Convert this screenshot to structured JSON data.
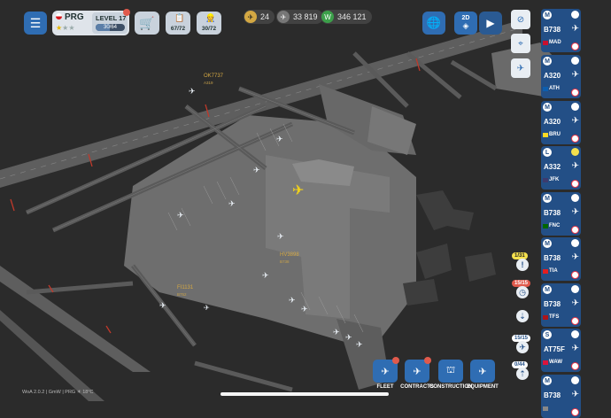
{
  "hud": {
    "airport_code": "PRG",
    "level_label": "LEVEL 17",
    "xp_progress": "30/64",
    "stand_count": "67/72",
    "staff_count": "30/72",
    "stat_planes": "24",
    "stat_coins": "33 819",
    "stat_money": "346 121",
    "view_mode": "2D"
  },
  "flights_map": [
    {
      "callsign": "OK7737",
      "type": "A319"
    },
    {
      "callsign": "HV3898",
      "type": "B738"
    },
    {
      "callsign": "FI1131",
      "type": "B752"
    }
  ],
  "sidebar_cards": [
    {
      "tag": "M",
      "model": "B738",
      "dest": "MAD",
      "flag_color": "#c8102e"
    },
    {
      "tag": "M",
      "model": "A320",
      "dest": "ATH",
      "flag_color": "#0d5eaf"
    },
    {
      "tag": "M",
      "model": "A320",
      "dest": "BRU",
      "flag_color": "#fdda24"
    },
    {
      "tag": "L",
      "model": "A332",
      "dest": "JFK",
      "flag_color": "#3c3b6e"
    },
    {
      "tag": "M",
      "model": "B738",
      "dest": "FNC",
      "flag_color": "#006600"
    },
    {
      "tag": "M",
      "model": "B738",
      "dest": "TIA",
      "flag_color": "#e41e20"
    },
    {
      "tag": "M",
      "model": "B738",
      "dest": "TFS",
      "flag_color": "#aa151b"
    },
    {
      "tag": "S",
      "model": "AT75F",
      "dest": "WAW",
      "flag_color": "#dc143c"
    },
    {
      "tag": "M",
      "model": "B738",
      "dest": "",
      "flag_color": "#888888"
    }
  ],
  "queues": [
    {
      "value": "1/31",
      "bg": "#f4e04d",
      "fg": "#222"
    },
    {
      "value": "15/15",
      "bg": "#e05a4c",
      "fg": "#fff"
    },
    {
      "value": "15/15",
      "bg": "#ffffff",
      "fg": "#234f86"
    },
    {
      "value": "0/44",
      "bg": "#ffffff",
      "fg": "#234f86"
    }
  ],
  "bottom_menu": {
    "fleet": "FLEET",
    "contracts": "CONTRACTS",
    "construction": "CONSTRUCTION",
    "equipment": "EQUIPMENT"
  },
  "footer": "WoA 2.0.2 | GmW | PRG ☀ 18°C",
  "colors": {
    "accent": "#2f6db3",
    "card": "#234f86",
    "alert": "#e05a4c"
  }
}
